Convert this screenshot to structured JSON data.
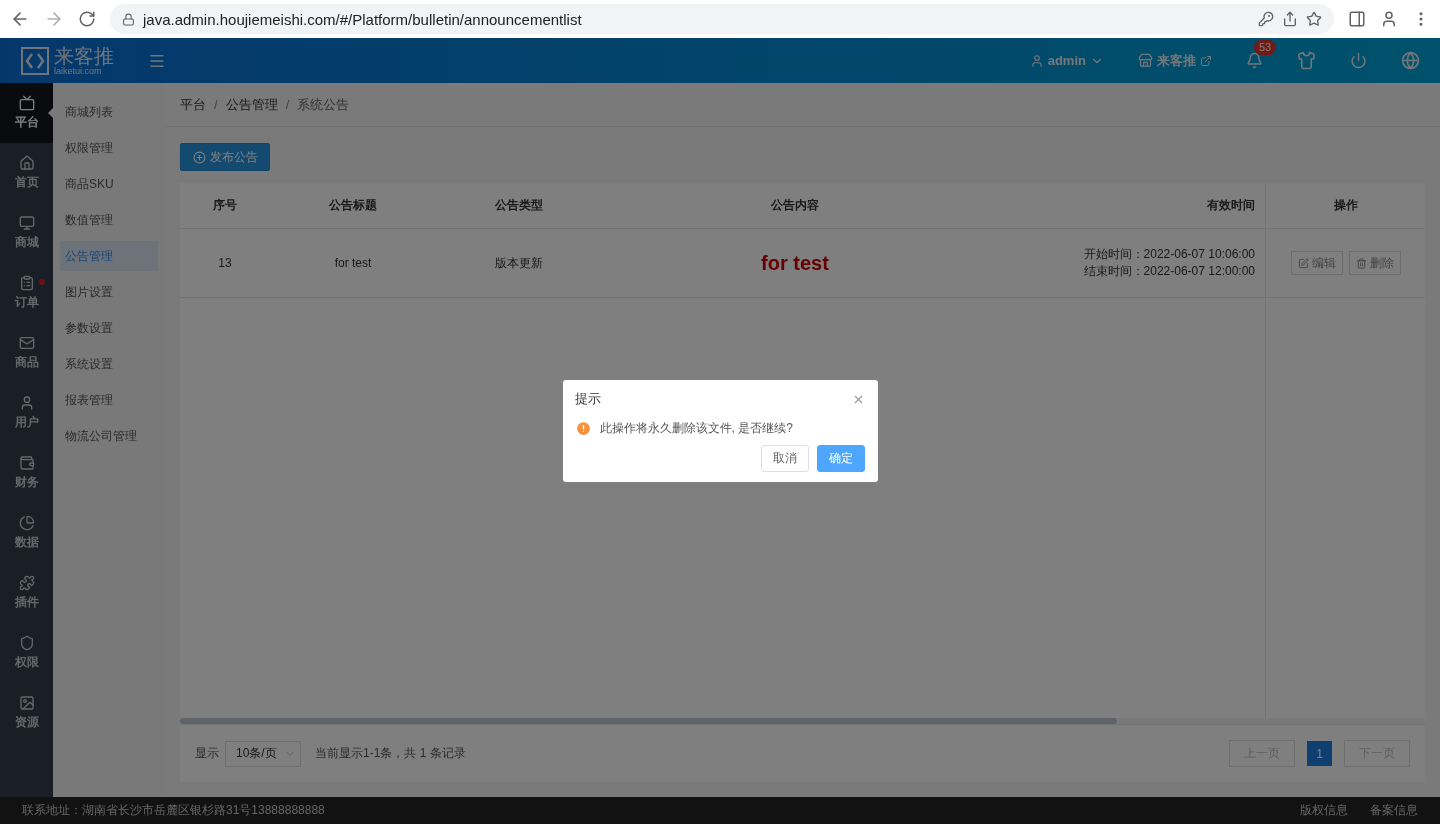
{
  "browser": {
    "url": "java.admin.houjiemeishi.com/#/Platform/bulletin/announcementlist"
  },
  "header": {
    "logo_text": "来客推",
    "logo_sub": "laiketui.com",
    "user": "admin",
    "store": "来客推",
    "notifications": "53"
  },
  "rail": [
    {
      "label": "平台",
      "selected": true,
      "dot": false
    },
    {
      "label": "首页",
      "selected": false,
      "dot": false
    },
    {
      "label": "商城",
      "selected": false,
      "dot": false
    },
    {
      "label": "订单",
      "selected": false,
      "dot": true
    },
    {
      "label": "商品",
      "selected": false,
      "dot": false
    },
    {
      "label": "用户",
      "selected": false,
      "dot": false
    },
    {
      "label": "财务",
      "selected": false,
      "dot": false
    },
    {
      "label": "数据",
      "selected": false,
      "dot": false
    },
    {
      "label": "插件",
      "selected": false,
      "dot": false
    },
    {
      "label": "权限",
      "selected": false,
      "dot": false
    },
    {
      "label": "资源",
      "selected": false,
      "dot": false
    }
  ],
  "submenu": [
    {
      "label": "商城列表",
      "selected": false
    },
    {
      "label": "权限管理",
      "selected": false
    },
    {
      "label": "商品SKU",
      "selected": false
    },
    {
      "label": "数值管理",
      "selected": false
    },
    {
      "label": "公告管理",
      "selected": true
    },
    {
      "label": "图片设置",
      "selected": false
    },
    {
      "label": "参数设置",
      "selected": false
    },
    {
      "label": "系统设置",
      "selected": false
    },
    {
      "label": "报表管理",
      "selected": false
    },
    {
      "label": "物流公司管理",
      "selected": false
    }
  ],
  "breadcrumb": {
    "items": [
      "平台",
      "公告管理",
      "系统公告"
    ],
    "separators": [
      "/",
      "/"
    ]
  },
  "publish_button": "发布公告",
  "table": {
    "columns": [
      "序号",
      "公告标题",
      "公告类型",
      "公告内容",
      "有效时间",
      "操作"
    ],
    "rows": [
      {
        "id": "13",
        "title": "for test",
        "type": "版本更新",
        "content": "for test",
        "start": "开始时间：2022-06-07 10:06:00",
        "end": "结束时间：2022-06-07 12:00:00",
        "actions": [
          "编辑",
          "删除"
        ]
      }
    ]
  },
  "pagination": {
    "show_label": "显示",
    "page_size": "10条/页",
    "summary": "当前显示1-1条，共 1 条记录",
    "prev": "上一页",
    "pages": [
      {
        "label": "1",
        "selected": true
      }
    ],
    "next": "下一页"
  },
  "footer": {
    "address": "联系地址：湖南省长沙市岳麓区银杉路31号13888888888",
    "links": [
      "版权信息",
      "备案信息"
    ]
  },
  "dialog": {
    "title": "提示",
    "message": "此操作将永久删除该文件, 是否继续?",
    "cancel": "取消",
    "confirm": "确定"
  }
}
